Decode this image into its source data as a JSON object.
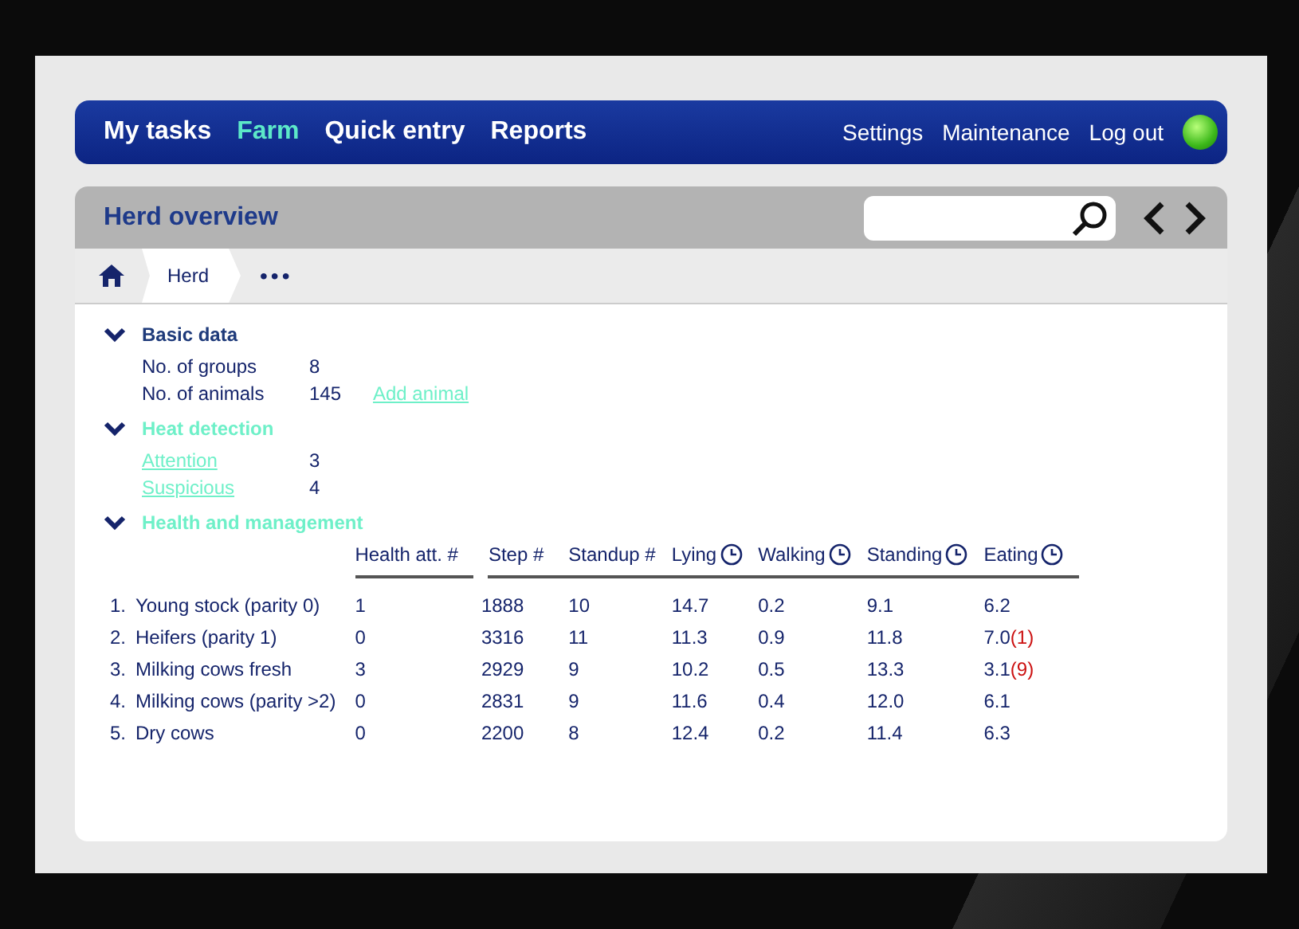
{
  "nav": {
    "items": [
      {
        "label": "My tasks",
        "selected": false
      },
      {
        "label": "Farm",
        "selected": true
      },
      {
        "label": "Quick entry",
        "selected": false
      },
      {
        "label": "Reports",
        "selected": false
      }
    ],
    "links": [
      "Settings",
      "Maintenance",
      "Log out"
    ]
  },
  "panel": {
    "title": "Herd overview"
  },
  "breadcrumb": {
    "items": [
      "Herd"
    ],
    "more": "•••"
  },
  "sections": [
    {
      "title": "Basic data",
      "expanded": true,
      "kind": "facts",
      "title_link": false,
      "rows": [
        {
          "label": "No. of groups",
          "label_link": false,
          "value": "8"
        },
        {
          "label": "No. of animals",
          "label_link": false,
          "value": "145",
          "action": "Add animal"
        }
      ]
    },
    {
      "title": "Heat detection",
      "expanded": true,
      "kind": "facts",
      "title_link": true,
      "rows": [
        {
          "label": "Attention",
          "label_link": true,
          "value": "3"
        },
        {
          "label": "Suspicious",
          "label_link": true,
          "value": "4"
        }
      ]
    },
    {
      "title": "Health and management",
      "expanded": true,
      "kind": "table",
      "title_link": true,
      "columns": [
        {
          "label": "Health att. #",
          "timed": false
        },
        {
          "label": "Step #",
          "timed": false
        },
        {
          "label": "Standup #",
          "timed": false
        },
        {
          "label": "Lying",
          "timed": true
        },
        {
          "label": "Walking",
          "timed": true
        },
        {
          "label": "Standing",
          "timed": true
        },
        {
          "label": "Eating",
          "timed": true
        }
      ],
      "rows": [
        {
          "index": "1.",
          "name": "Young stock (parity 0)",
          "cells": [
            {
              "value": "1"
            },
            {
              "value": "1888"
            },
            {
              "value": "10"
            },
            {
              "value": "14.7"
            },
            {
              "value": "0.2"
            },
            {
              "value": "9.1"
            },
            {
              "value": "6.2"
            }
          ]
        },
        {
          "index": "2.",
          "name": "Heifers (parity 1)",
          "cells": [
            {
              "value": "0"
            },
            {
              "value": "3316"
            },
            {
              "value": "11"
            },
            {
              "value": "11.3"
            },
            {
              "value": "0.9"
            },
            {
              "value": "11.8"
            },
            {
              "value": "7.0",
              "alert": "(1)"
            }
          ]
        },
        {
          "index": "3.",
          "name": "Milking cows fresh",
          "cells": [
            {
              "value": "3"
            },
            {
              "value": "2929"
            },
            {
              "value": "9"
            },
            {
              "value": "10.2"
            },
            {
              "value": "0.5"
            },
            {
              "value": "13.3"
            },
            {
              "value": "3.1",
              "alert": "(9)"
            }
          ]
        },
        {
          "index": "4.",
          "name": "Milking cows (parity >2)",
          "cells": [
            {
              "value": "0"
            },
            {
              "value": "2831"
            },
            {
              "value": "9"
            },
            {
              "value": "11.6"
            },
            {
              "value": "0.4"
            },
            {
              "value": "12.0"
            },
            {
              "value": "6.1"
            }
          ]
        },
        {
          "index": "5.",
          "name": "Dry cows",
          "cells": [
            {
              "value": "0"
            },
            {
              "value": "2200"
            },
            {
              "value": "8"
            },
            {
              "value": "12.4"
            },
            {
              "value": "0.2"
            },
            {
              "value": "11.4"
            },
            {
              "value": "6.3"
            }
          ]
        }
      ]
    }
  ]
}
